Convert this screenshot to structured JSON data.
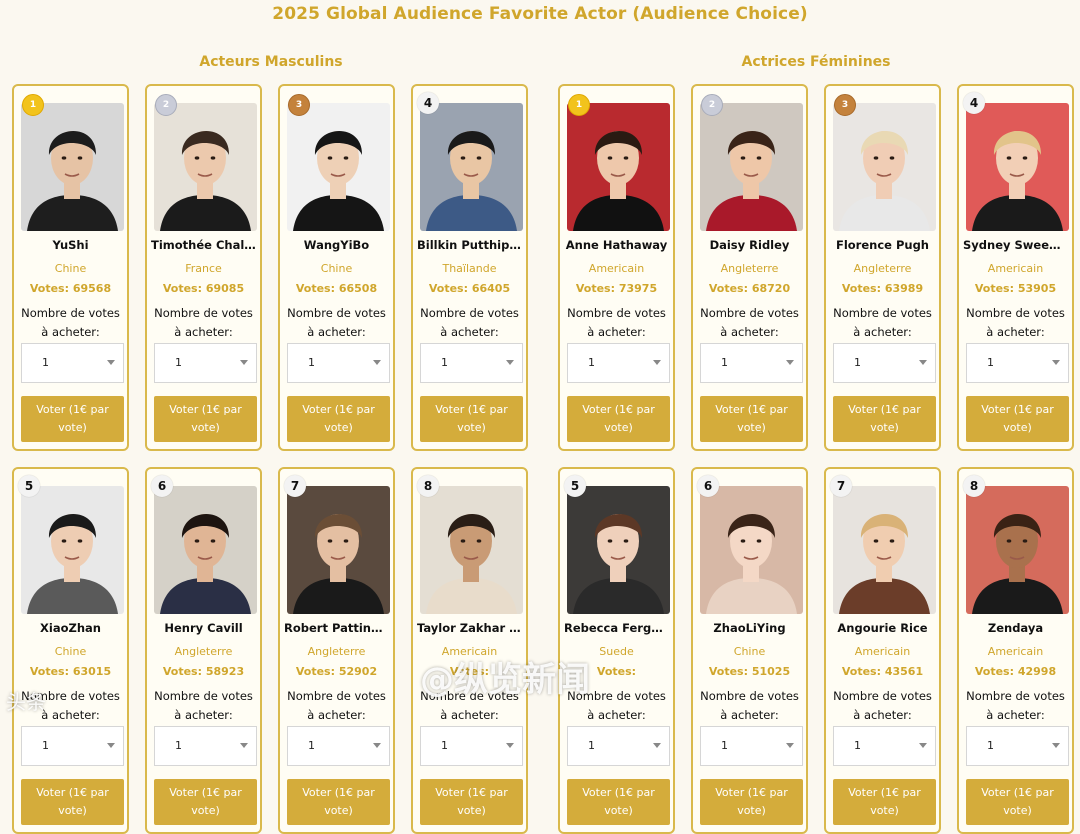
{
  "page": {
    "title": "2025 Global Audience Favorite Actor (Audience Choice)",
    "sections": {
      "male": "Acteurs Masculins",
      "female": "Actrices Féminines"
    },
    "buy_label_line1": "Nombre de votes",
    "buy_label_line2": "à acheter:",
    "qty_value": "1",
    "vote_button_label": "Voter (1€ par vote)",
    "votes_prefix": "Votes:",
    "watermark": "@纵览新闻",
    "watermark_small": "头条",
    "colors": {
      "accent": "#d0a62c",
      "button": "#d4ac3b",
      "border": "#d9b94c"
    }
  },
  "male": [
    {
      "rank": "1",
      "medal": "gold",
      "name": "YuShi",
      "country": "Chine",
      "votes": "69568",
      "bg": "#d7d7d7",
      "skin": "#e6c3a5",
      "hair": "#1c1c1c",
      "outfit": "#1e1e1e"
    },
    {
      "rank": "2",
      "medal": "silver",
      "name": "Timothée Chala...",
      "country": "France",
      "votes": "69085",
      "bg": "#e6e1d8",
      "skin": "#ecc9ad",
      "hair": "#3a2a20",
      "outfit": "#1b1b1b"
    },
    {
      "rank": "3",
      "medal": "bronze",
      "name": "WangYiBo",
      "country": "Chine",
      "votes": "66508",
      "bg": "#f1f1f1",
      "skin": "#eed0b6",
      "hair": "#161616",
      "outfit": "#151515"
    },
    {
      "rank": "4",
      "medal": "",
      "name": "Billkin Putthipo...",
      "country": "Thaïlande",
      "votes": "66405",
      "bg": "#9aa3b0",
      "skin": "#e9c6a4",
      "hair": "#1a1a1a",
      "outfit": "#3d5a86"
    },
    {
      "rank": "5",
      "medal": "",
      "name": "XiaoZhan",
      "country": "Chine",
      "votes": "63015",
      "bg": "#e8e8e8",
      "skin": "#eecdb3",
      "hair": "#1a1a1a",
      "outfit": "#5a5a5a"
    },
    {
      "rank": "6",
      "medal": "",
      "name": "Henry Cavill",
      "country": "Angleterre",
      "votes": "58923",
      "bg": "#d5d1c8",
      "skin": "#e0b595",
      "hair": "#1d1410",
      "outfit": "#2a2f45"
    },
    {
      "rank": "7",
      "medal": "",
      "name": "Robert Pattinson",
      "country": "Angleterre",
      "votes": "52902",
      "bg": "#5a4a3e",
      "skin": "#e4bfa2",
      "hair": "#6b4e36",
      "outfit": "#1a1a1a"
    },
    {
      "rank": "8",
      "medal": "",
      "name": "Taylor Zakhar P...",
      "country": "Americain",
      "votes": "",
      "bg": "#e4ded3",
      "skin": "#c99b75",
      "hair": "#2a1e16",
      "outfit": "#e8dccb"
    }
  ],
  "female": [
    {
      "rank": "1",
      "medal": "gold",
      "name": "Anne Hathaway",
      "country": "Americain",
      "votes": "73975",
      "bg": "#b92a2f",
      "skin": "#eec8ab",
      "hair": "#2a1a12",
      "outfit": "#111111"
    },
    {
      "rank": "2",
      "medal": "silver",
      "name": "Daisy Ridley",
      "country": "Angleterre",
      "votes": "68720",
      "bg": "#cfc8c0",
      "skin": "#eec7a8",
      "hair": "#3a2418",
      "outfit": "#a9192a"
    },
    {
      "rank": "3",
      "medal": "bronze",
      "name": "Florence Pugh",
      "country": "Angleterre",
      "votes": "63989",
      "bg": "#e9e6e3",
      "skin": "#f0cdb5",
      "hair": "#e9d9b4",
      "outfit": "#e8e8e8"
    },
    {
      "rank": "4",
      "medal": "",
      "name": "Sydney Sween...",
      "country": "Americain",
      "votes": "53905",
      "bg": "#e05a58",
      "skin": "#f2cfb6",
      "hair": "#e2c48a",
      "outfit": "#1a1a1a"
    },
    {
      "rank": "5",
      "medal": "",
      "name": "Rebecca Fergu...",
      "country": "Suede",
      "votes": "",
      "bg": "#3c3a38",
      "skin": "#efd0bb",
      "hair": "#5c3826",
      "outfit": "#2a2a2a"
    },
    {
      "rank": "6",
      "medal": "",
      "name": "ZhaoLiYing",
      "country": "Chine",
      "votes": "51025",
      "bg": "#d7b8a6",
      "skin": "#f4d8c6",
      "hair": "#3a2418",
      "outfit": "#e8d2c3"
    },
    {
      "rank": "7",
      "medal": "",
      "name": "Angourie Rice",
      "country": "Americain",
      "votes": "43561",
      "bg": "#e7e3de",
      "skin": "#f0cdb0",
      "hair": "#d9b277",
      "outfit": "#6b3d29"
    },
    {
      "rank": "8",
      "medal": "",
      "name": "Zendaya",
      "country": "Americain",
      "votes": "42998",
      "bg": "#d56b5c",
      "skin": "#a9714d",
      "hair": "#3a2215",
      "outfit": "#1a1a1a"
    }
  ]
}
